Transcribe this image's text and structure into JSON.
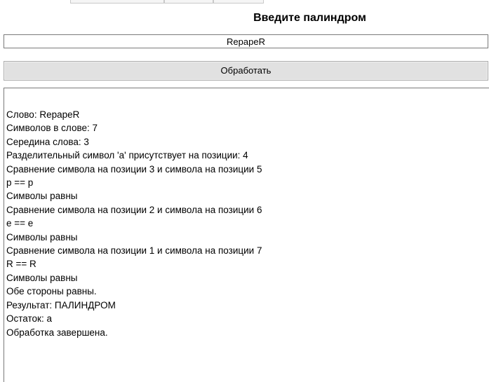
{
  "header": {
    "title": "Введите палиндром"
  },
  "input": {
    "value": "RepapeR"
  },
  "button": {
    "label": "Обработать"
  },
  "output": {
    "lines": [
      "Слово: RepapeR",
      "Символов в слове: 7",
      "Середина слова: 3",
      "Разделительный символ 'a' присутствует на позиции: 4",
      "Сравнение символа на позиции 3 и символа на позиции 5",
      "p == p",
      "Символы равны",
      "Сравнение символа на позиции 2 и символа на позиции 6",
      "e == e",
      "Символы равны",
      "Сравнение символа на позиции 1 и символа на позиции 7",
      "R == R",
      "Символы равны",
      "Обе стороны равны.",
      "Результат: ПАЛИНДРОМ",
      "Остаток: a",
      "Обработка завершена."
    ]
  }
}
